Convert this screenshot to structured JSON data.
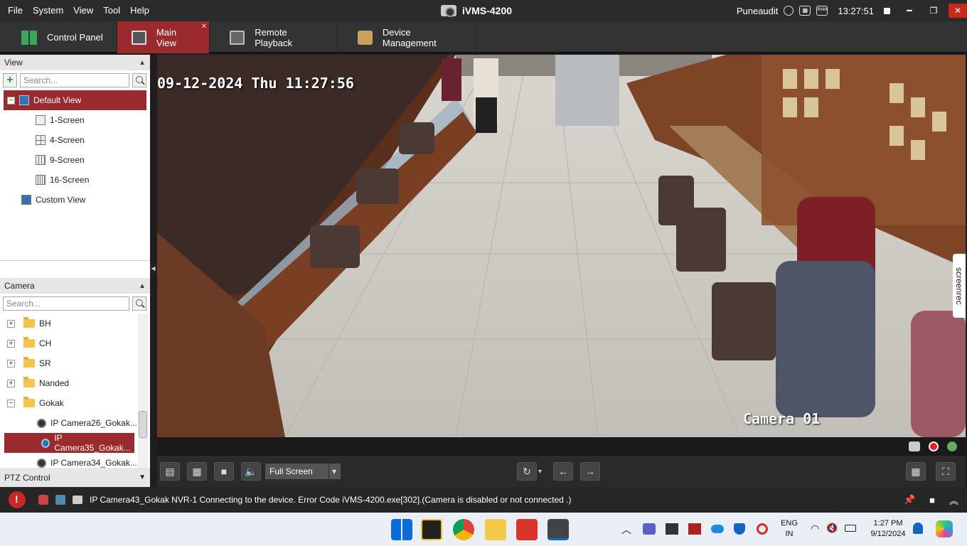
{
  "menu": [
    "File",
    "System",
    "View",
    "Tool",
    "Help"
  ],
  "app_title": "iVMS-4200",
  "title_right": {
    "user": "Puneaudit",
    "time": "13:27:51"
  },
  "tabs": [
    {
      "label": "Control Panel"
    },
    {
      "label": "Main View"
    },
    {
      "label": "Remote Playback"
    },
    {
      "label": "Device Management"
    }
  ],
  "view_panel": {
    "title": "View",
    "search_placeholder": "Search...",
    "default_view": "Default View",
    "items": [
      "1-Screen",
      "4-Screen",
      "9-Screen",
      "16-Screen"
    ],
    "custom_view": "Custom View"
  },
  "camera_panel": {
    "title": "Camera",
    "search_placeholder": "Search...",
    "groups": [
      "BH",
      "CH",
      "SR",
      "Nanded",
      "Gokak"
    ],
    "cameras": [
      "IP Camera26_Gokak...",
      "IP Camera35_Gokak...",
      "IP Camera34_Gokak..."
    ]
  },
  "ptz": {
    "label": "PTZ Control"
  },
  "video": {
    "timestamp": "09-12-2024 Thu 11:27:56",
    "camera_label": "Camera 01",
    "overlay_app": "screenrec"
  },
  "controls": {
    "screen_mode": "Full Screen"
  },
  "statusbar": {
    "message": "IP Camera43_Gokak NVR-1 Connecting to the device. Error Code iVMS-4200.exe[302].(Camera is disabled or not connected .)"
  },
  "taskbar": {
    "lang_line1": "ENG",
    "lang_line2": "IN",
    "time": "1:27 PM",
    "date": "9/12/2024"
  },
  "colors": {
    "accent": "#9a2a2e",
    "background": "#1e1e1e",
    "panel": "#ffffff"
  }
}
